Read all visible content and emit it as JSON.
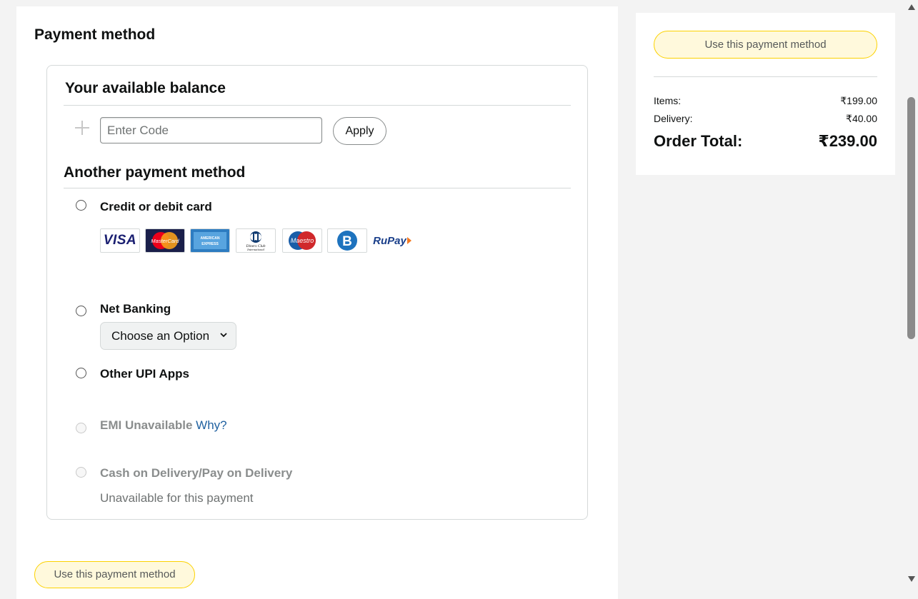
{
  "payment": {
    "title": "Payment method",
    "balance_heading": "Your available balance",
    "code_placeholder": "Enter Code",
    "apply_label": "Apply",
    "another_heading": "Another payment method",
    "options": {
      "card_label": "Credit or debit card",
      "netbanking_label": "Net Banking",
      "netbanking_select": "Choose an Option",
      "upi_label": "Other UPI Apps",
      "emi_label": "EMI Unavailable",
      "emi_link": "Why?",
      "cod_label": "Cash on Delivery/Pay on Delivery",
      "cod_note": "Unavailable for this payment"
    },
    "card_logos": {
      "visa": "VISA",
      "mastercard": "MasterCard",
      "amex": "AMERICAN EXPRESS",
      "diners": "Diners Club International",
      "maestro": "Maestro",
      "bajaj": "B",
      "rupay": "RuPay"
    },
    "bottom_button": "Use this payment method"
  },
  "summary": {
    "button": "Use this payment method",
    "items_label": "Items:",
    "items_value": "₹199.00",
    "delivery_label": "Delivery:",
    "delivery_value": "₹40.00",
    "total_label": "Order Total:",
    "total_value": "₹239.00"
  },
  "colors": {
    "accent_yellow_bg": "#fff9dc",
    "accent_yellow_border": "#fcd200",
    "link_blue": "#2162a1",
    "page_bg": "#f3f3f3"
  }
}
